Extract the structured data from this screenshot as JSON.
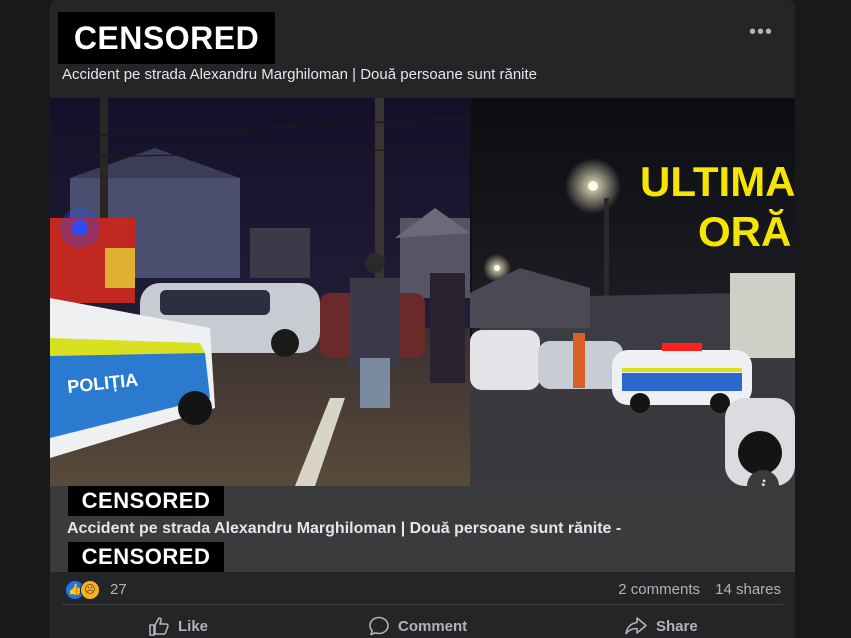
{
  "post": {
    "censor_label_top": "CENSORED",
    "more_menu_icon": "•••",
    "headline": "Accident pe strada Alexandru Marghiloman | Două persoane sunt rănite"
  },
  "media": {
    "overlay_text_line1": "ULTIMA",
    "overlay_text_line2": "ORĂ",
    "police_car_text": "POLIȚIA",
    "info_icon": "i"
  },
  "link_preview": {
    "censor_label_domain": "CENSORED",
    "title": "Accident pe strada Alexandru Marghiloman | Două persoane sunt rănite -",
    "censor_label_bottom": "CENSORED"
  },
  "stats": {
    "reactions_count": "27",
    "comments": "2 comments",
    "shares": "14 shares"
  },
  "actions": {
    "like_label": "Like",
    "comment_label": "Comment",
    "share_label": "Share"
  },
  "colors": {
    "card_bg": "#242526",
    "preview_bg": "#3a3b3c",
    "overlay_yellow": "#f5e500",
    "like_blue": "#1877f2"
  }
}
